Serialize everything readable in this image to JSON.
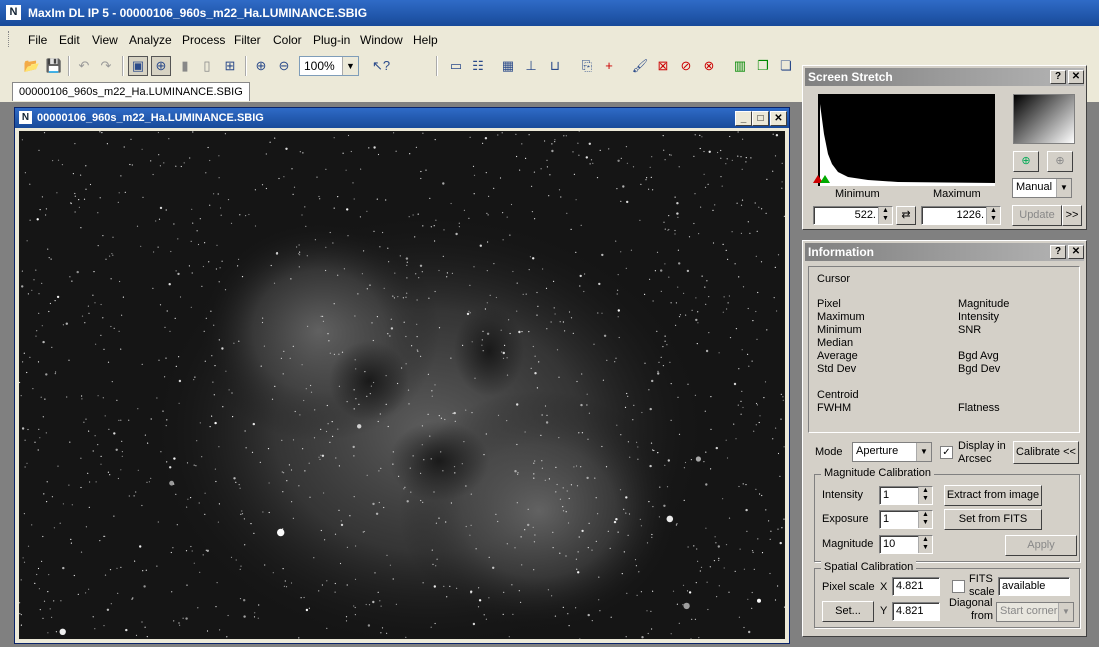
{
  "app": {
    "title": "MaxIm DL IP 5 - 00000106_960s_m22_Ha.LUMINANCE.SBIG",
    "logo": "N"
  },
  "menu": [
    "File",
    "Edit",
    "View",
    "Analyze",
    "Process",
    "Filter",
    "Color",
    "Plug-in",
    "Window",
    "Help"
  ],
  "toolbar": {
    "zoom_value": "100%",
    "icons": [
      "open-icon",
      "save-icon",
      "undo-icon",
      "redo-icon",
      "select-icon",
      "crosshair-icon",
      "stamp-icon",
      "lock-icon",
      "grid-icon",
      "zoom-in-icon",
      "zoom-out-icon"
    ]
  },
  "tab": {
    "label": "00000106_960s_m22_Ha.LUMINANCE.SBIG"
  },
  "image_window": {
    "title": "00000106_960s_m22_Ha.LUMINANCE.SBIG",
    "buttons": {
      "minimize": "_",
      "maximize": "□",
      "close": "✕"
    }
  },
  "screen_stretch": {
    "title": "Screen Stretch",
    "help": "?",
    "close": "✕",
    "minimum_label": "Minimum",
    "maximum_label": "Maximum",
    "minimum_value": "522.",
    "maximum_value": "1226.",
    "mode": "Manual",
    "update_label": "Update",
    "expand_label": ">>"
  },
  "information": {
    "title": "Information",
    "help": "?",
    "close": "✕",
    "cursor_label": "Cursor",
    "left_labels": [
      "Pixel",
      "Maximum",
      "Minimum",
      "Median",
      "Average",
      "Std Dev",
      "",
      "Centroid",
      "FWHM"
    ],
    "right_labels": [
      "Magnitude",
      "Intensity",
      "SNR",
      "",
      "Bgd Avg",
      "Bgd Dev",
      "",
      "",
      "Flatness"
    ],
    "mode_label": "Mode",
    "mode_value": "Aperture",
    "display_in": "Display in",
    "arcsec": "Arcsec",
    "calibrate_label": "Calibrate <<",
    "mag_cal": {
      "title": "Magnitude Calibration",
      "intensity_label": "Intensity",
      "intensity_value": "1",
      "exposure_label": "Exposure",
      "exposure_value": "1",
      "magnitude_label": "Magnitude",
      "magnitude_value": "10",
      "extract_label": "Extract from image",
      "fits_label": "Set from FITS",
      "apply_label": "Apply"
    },
    "spatial_cal": {
      "title": "Spatial Calibration",
      "pixel_scale_label": "Pixel scale",
      "x_label": "X",
      "x_value": "4.821",
      "y_label": "Y",
      "y_value": "4.821",
      "set_label": "Set...",
      "fits_label": "FITS",
      "scale_label": "scale",
      "available_value": "available",
      "diagonal_label": "Diagonal",
      "from_label": "from",
      "start_corner": "Start corner"
    }
  }
}
